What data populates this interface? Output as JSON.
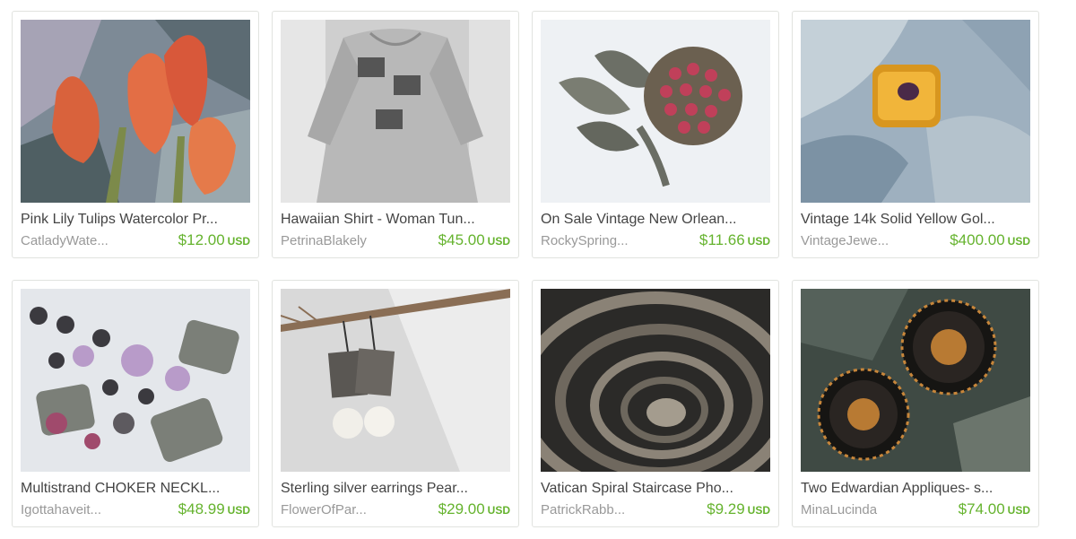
{
  "listings": [
    {
      "title": "Pink Lily Tulips Watercolor Pr...",
      "shop": "CatladyWate...",
      "price": "$12.00",
      "currency": "USD",
      "image": "watercolor-tulips-image"
    },
    {
      "title": "Hawaiian Shirt - Woman Tun...",
      "shop": "PetrinaBlakely",
      "price": "$45.00",
      "currency": "USD",
      "image": "dragonfly-shirt-image"
    },
    {
      "title": "On Sale Vintage New Orlean...",
      "shop": "RockySpring...",
      "price": "$11.66",
      "currency": "USD",
      "image": "flower-brooch-image"
    },
    {
      "title": "Vintage 14k Solid Yellow Gol...",
      "shop": "VintageJewe...",
      "price": "$400.00",
      "currency": "USD",
      "image": "gold-ring-image"
    },
    {
      "title": "Multistrand CHOKER NECKL...",
      "shop": "Igottahaveit...",
      "price": "$48.99",
      "currency": "USD",
      "image": "bead-necklace-image"
    },
    {
      "title": "Sterling silver earrings Pear...",
      "shop": "FlowerOfPar...",
      "price": "$29.00",
      "currency": "USD",
      "image": "pearl-earrings-image"
    },
    {
      "title": "Vatican Spiral Staircase Pho...",
      "shop": "PatrickRabb...",
      "price": "$9.29",
      "currency": "USD",
      "image": "spiral-staircase-image"
    },
    {
      "title": "Two Edwardian Appliques- s...",
      "shop": "MinaLucinda",
      "price": "$74.00",
      "currency": "USD",
      "image": "edwardian-appliques-image"
    }
  ],
  "colors": {
    "price": "#65b32e",
    "title": "#444444",
    "shop": "#999999",
    "border": "#e1e3df"
  }
}
